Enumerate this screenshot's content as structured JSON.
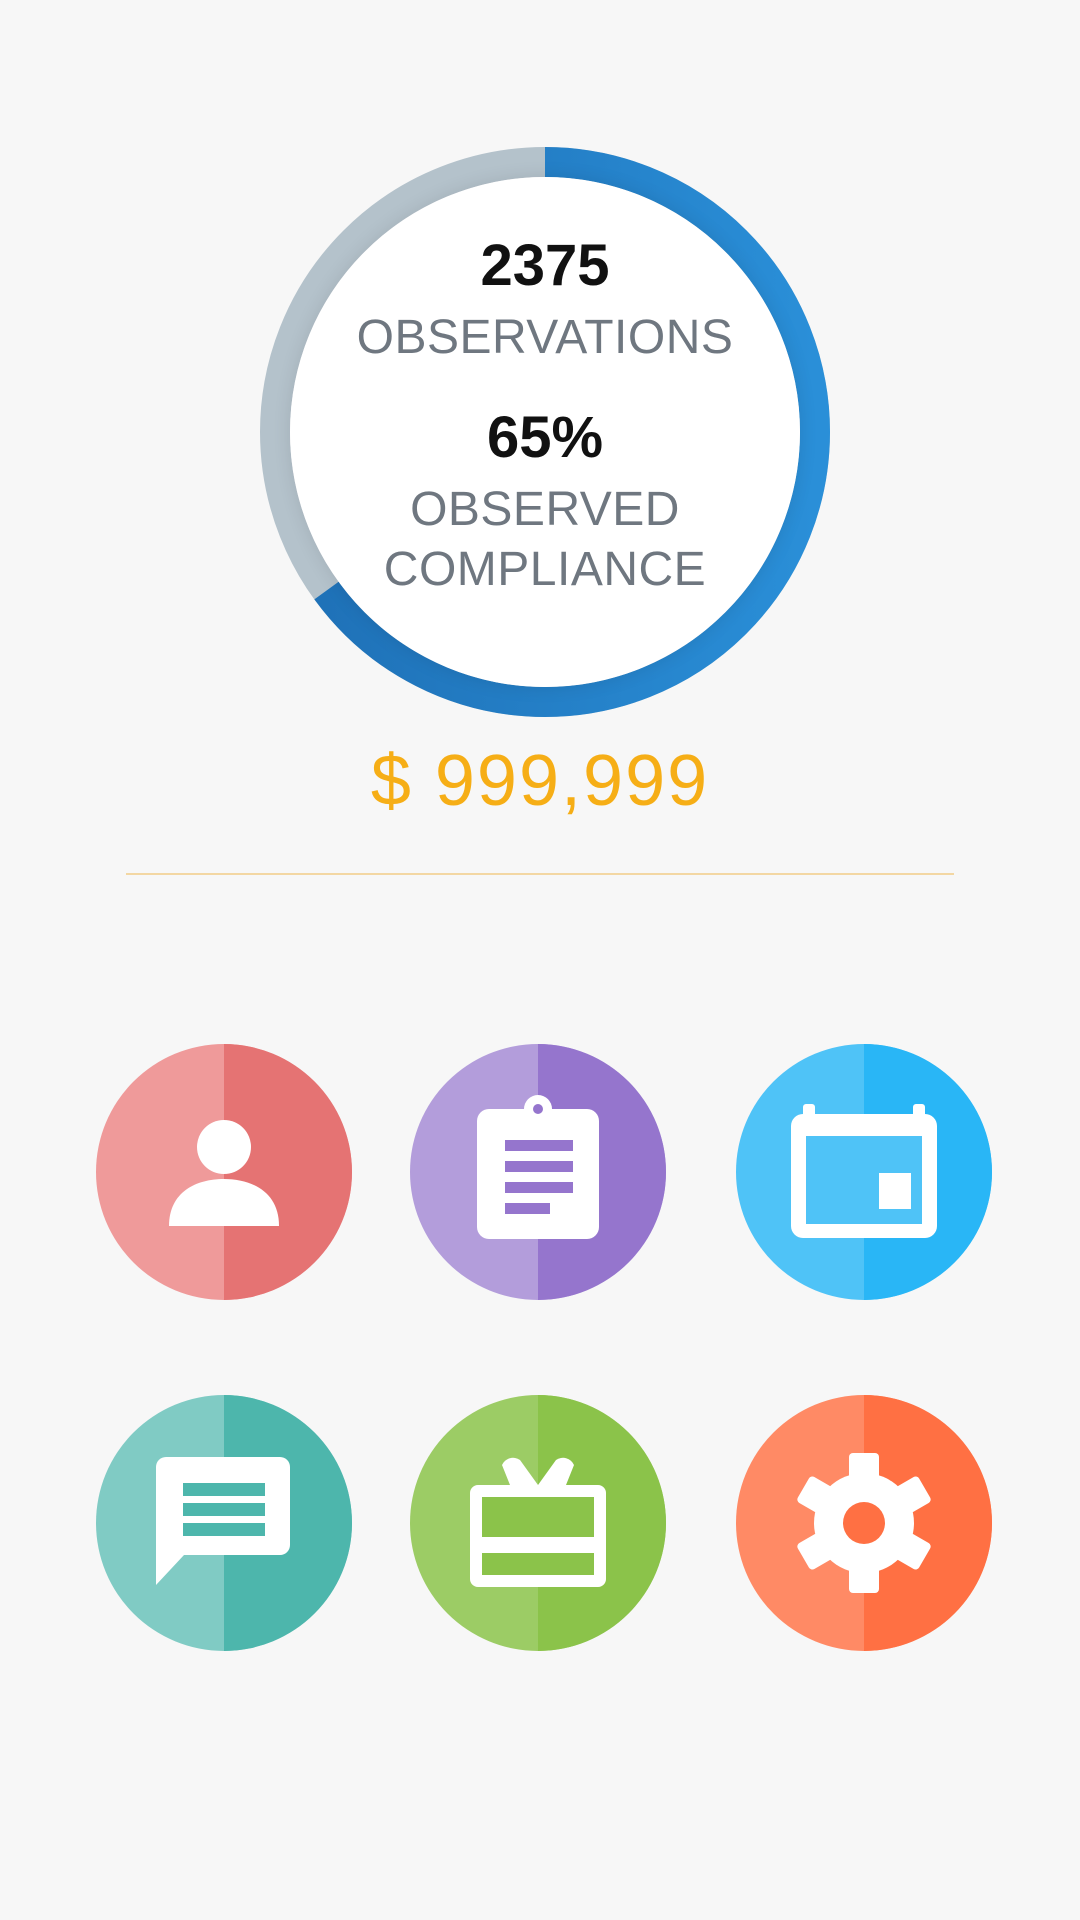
{
  "summary": {
    "observations_count": "2375",
    "observations_label": "OBSERVATIONS",
    "compliance_percent": "65%",
    "compliance_label": "OBSERVED COMPLIANCE",
    "compliance_fraction": 0.65
  },
  "amount": "$ 999,999",
  "colors": {
    "gauge_progress": "#1a73b8",
    "gauge_track": "#b0bec5",
    "amount": "#f6ae16",
    "divider": "#f3d7a3"
  },
  "tiles": [
    {
      "icon": "person-icon",
      "color": "#e57373"
    },
    {
      "icon": "clipboard-icon",
      "color": "#9575cd"
    },
    {
      "icon": "calendar-icon",
      "color": "#29b6f6"
    },
    {
      "icon": "chat-icon",
      "color": "#4db6ac"
    },
    {
      "icon": "gift-card-icon",
      "color": "#8bc34a"
    },
    {
      "icon": "settings-icon",
      "color": "#ff7043"
    }
  ]
}
